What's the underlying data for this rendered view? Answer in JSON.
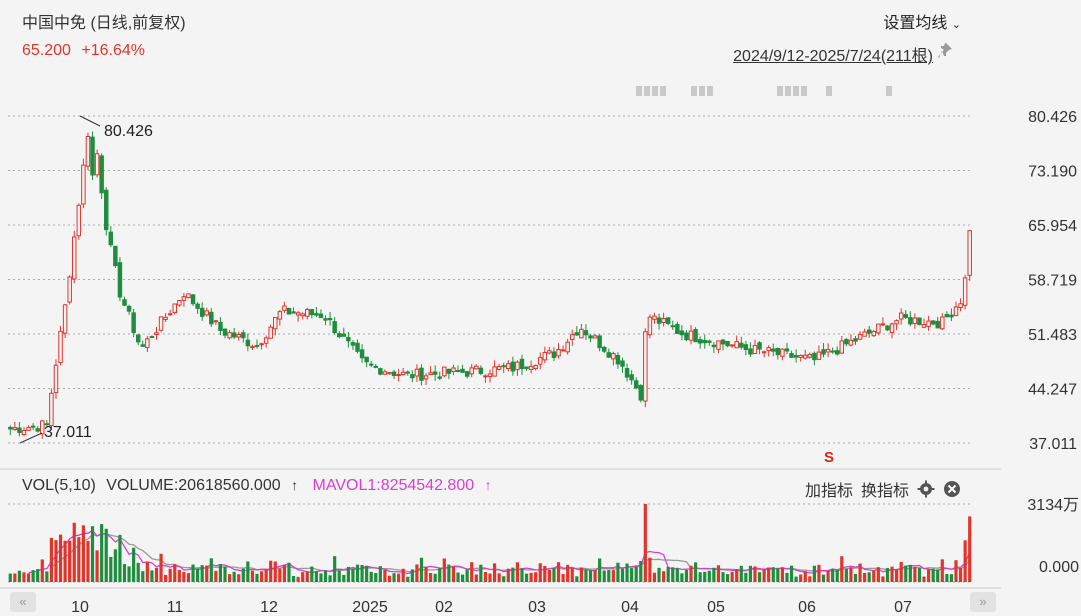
{
  "header": {
    "stock_title": "中国中免 (日线,前复权)",
    "price": "65.200",
    "change": "+16.64%",
    "ma_settings": "设置均线",
    "date_range": "2024/9/12-2025/7/24(211根)"
  },
  "volume_panel": {
    "label": "VOL(5,10)",
    "volume": "VOLUME:20618560.000",
    "mavol": "MAVOL1:8254542.800",
    "add_indicator": "加指标",
    "switch_indicator": "换指标"
  },
  "colors": {
    "up": "#e0352b",
    "down": "#1e8e3e",
    "ma5": "#d63fd6",
    "ma10": "#999999",
    "grid": "#aaaaaa"
  },
  "chart_data": {
    "type": "candlestick",
    "price_axis": {
      "range": [
        37.011,
        80.426
      ],
      "ticks": [
        "80.426",
        "73.190",
        "65.954",
        "58.719",
        "51.483",
        "44.247",
        "37.011"
      ]
    },
    "volume_axis": {
      "ticks": [
        "3134万",
        "0.000"
      ]
    },
    "x_labels": [
      "10",
      "11",
      "12",
      "2025",
      "02",
      "03",
      "04",
      "05",
      "06",
      "07"
    ],
    "annotations": {
      "high_label": "80.426",
      "low_label": "37.011",
      "signal": "S"
    },
    "series": [
      {
        "date": "2024-09-12",
        "close": 38.9
      },
      {
        "date": "2024-09-24",
        "close": 39.4
      },
      {
        "date": "2024-09-26",
        "close": 45.2
      },
      {
        "date": "2024-09-30",
        "close": 55.1
      },
      {
        "date": "2024-10-08",
        "close": 79.8
      },
      {
        "date": "2024-10-09",
        "close": 72.5
      },
      {
        "date": "2024-10-10",
        "close": 77.0
      },
      {
        "date": "2024-10-14",
        "close": 64.5
      },
      {
        "date": "2024-10-18",
        "close": 57.0
      },
      {
        "date": "2024-10-25",
        "close": 49.5
      },
      {
        "date": "2024-11-08",
        "close": 57.0
      },
      {
        "date": "2024-11-20",
        "close": 52.0
      },
      {
        "date": "2024-12-02",
        "close": 50.0
      },
      {
        "date": "2024-12-10",
        "close": 54.5
      },
      {
        "date": "2024-12-24",
        "close": 54.0
      },
      {
        "date": "2025-01-06",
        "close": 47.5
      },
      {
        "date": "2025-01-20",
        "close": 46.0
      },
      {
        "date": "2025-02-10",
        "close": 46.5
      },
      {
        "date": "2025-02-24",
        "close": 47.0
      },
      {
        "date": "2025-03-10",
        "close": 49.0
      },
      {
        "date": "2025-03-18",
        "close": 52.5
      },
      {
        "date": "2025-03-31",
        "close": 48.0
      },
      {
        "date": "2025-04-07",
        "close": 43.5
      },
      {
        "date": "2025-04-09",
        "close": 54.0
      },
      {
        "date": "2025-04-21",
        "close": 51.5
      },
      {
        "date": "2025-05-12",
        "close": 49.5
      },
      {
        "date": "2025-06-03",
        "close": 48.0
      },
      {
        "date": "2025-06-23",
        "close": 52.0
      },
      {
        "date": "2025-07-01",
        "close": 53.5
      },
      {
        "date": "2025-07-15",
        "close": 53.0
      },
      {
        "date": "2025-07-22",
        "close": 56.5
      },
      {
        "date": "2025-07-24",
        "close": 65.2
      }
    ]
  }
}
